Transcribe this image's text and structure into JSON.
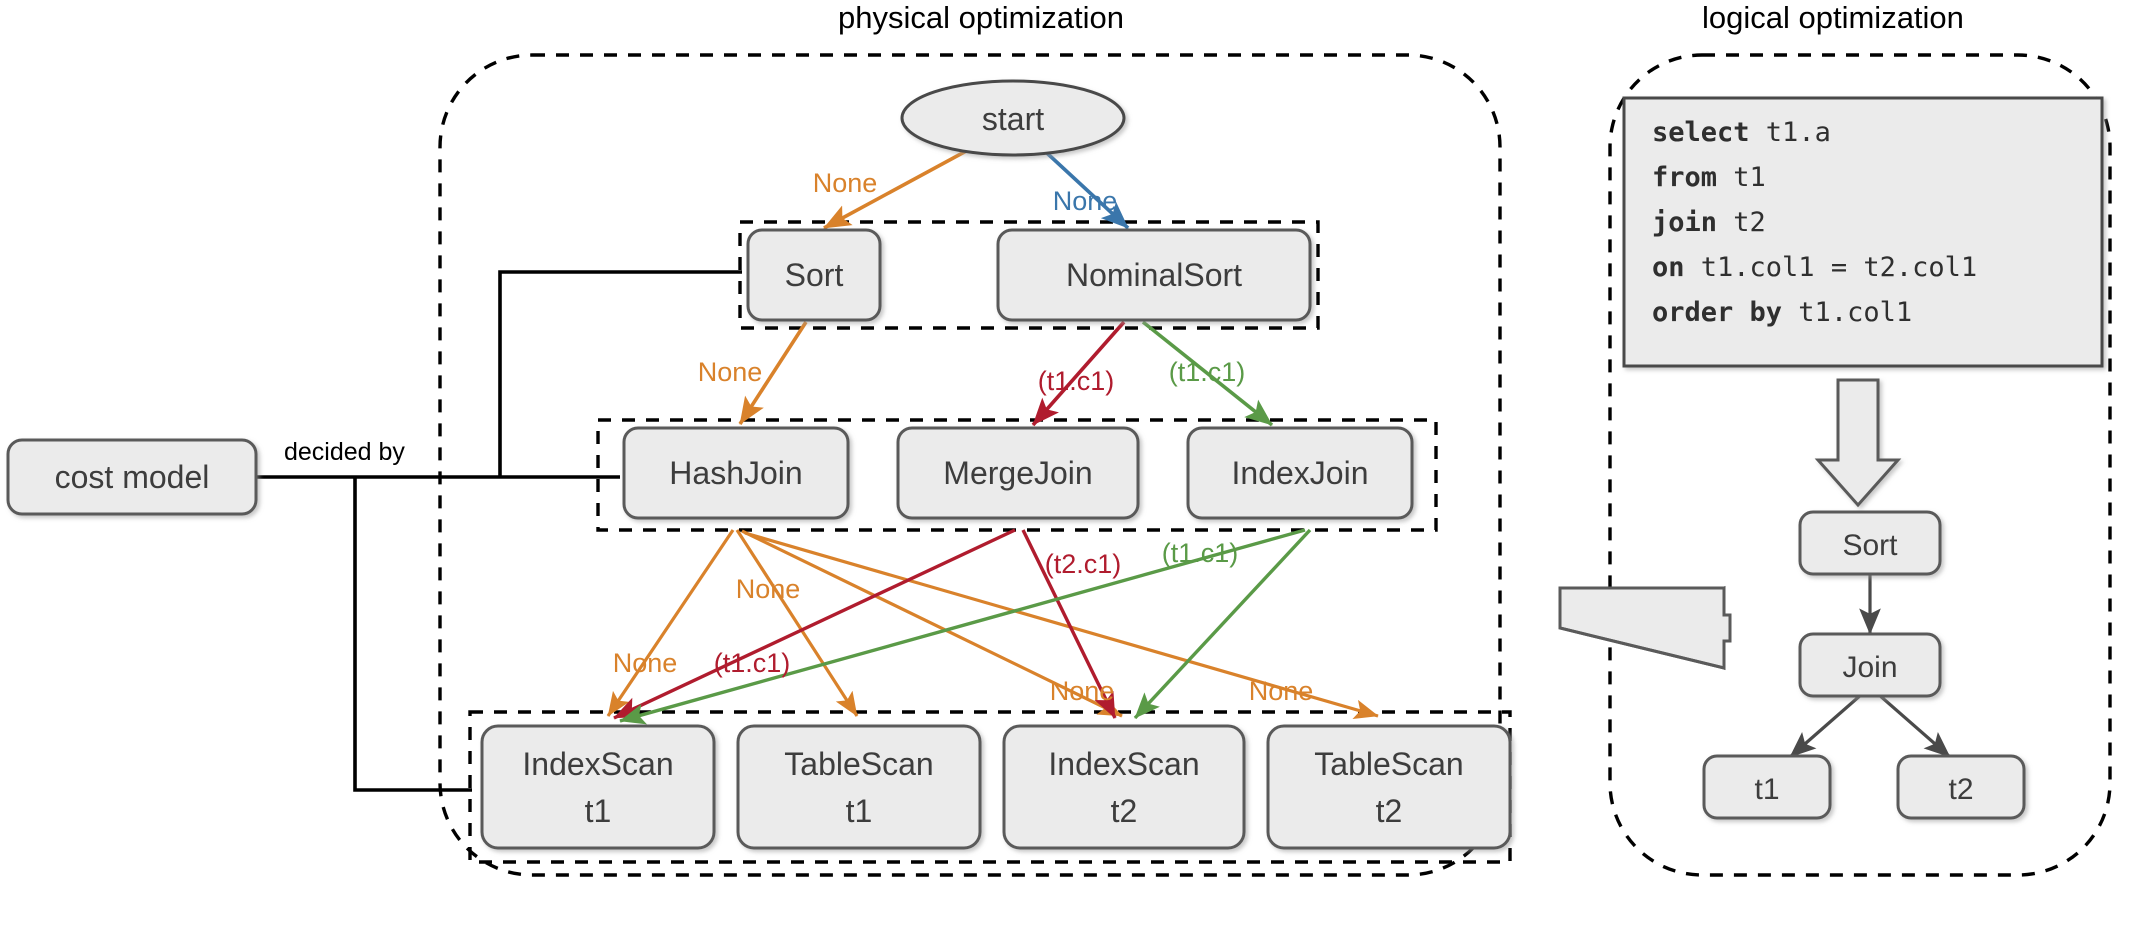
{
  "sections": {
    "physical": {
      "title": "physical optimization"
    },
    "logical": {
      "title": "logical optimization"
    }
  },
  "cost_model": {
    "label": "cost model",
    "edge_label": "decided by"
  },
  "physical": {
    "start_node": "start",
    "row_sort": [
      {
        "id": "sort",
        "label": "Sort"
      },
      {
        "id": "nominalsort",
        "label": "NominalSort"
      }
    ],
    "row_join": [
      {
        "id": "hashjoin",
        "label": "HashJoin"
      },
      {
        "id": "mergejoin",
        "label": "MergeJoin"
      },
      {
        "id": "indexjoin",
        "label": "IndexJoin"
      }
    ],
    "row_scan": [
      {
        "id": "indexscan_t1",
        "line1": "IndexScan",
        "line2": "t1"
      },
      {
        "id": "tablescan_t1",
        "line1": "TableScan",
        "line2": "t1"
      },
      {
        "id": "indexscan_t2",
        "line1": "IndexScan",
        "line2": "t2"
      },
      {
        "id": "tablescan_t2",
        "line1": "TableScan",
        "line2": "t2"
      }
    ],
    "edge_labels": {
      "start_to_sort": "None",
      "start_to_nominalsort": "None",
      "sort_to_hashjoin": "None",
      "nominalsort_to_mergejoin": "(t1.c1)",
      "nominalsort_to_indexjoin": "(t1.c1)",
      "hashjoin_to_indexscan_t1": "None",
      "hashjoin_to_tablescan_t1": "None",
      "hashjoin_to_indexscan_t2": "None",
      "hashjoin_to_tablescan_t2": "None",
      "mergejoin_to_indexscan_t1": "(t1.c1)",
      "mergejoin_to_indexscan_t2": "(t2.c1)",
      "indexjoin_to_indexscan_t1": "(t1.c1)"
    }
  },
  "logical": {
    "sql": [
      {
        "kw": "select",
        "rest": " t1.a"
      },
      {
        "kw": "from",
        "rest": " t1"
      },
      {
        "kw": "join",
        "rest": " t2"
      },
      {
        "kw": "on",
        "rest": " t1.col1 = t2.col1"
      },
      {
        "kw": "order by",
        "rest": " t1.col1"
      }
    ],
    "plan": {
      "sort": "Sort",
      "join": "Join",
      "t1": "t1",
      "t2": "t2"
    }
  },
  "colors": {
    "orange": "#d9822b",
    "blue": "#3a76ab",
    "red": "#b01c2e",
    "green": "#5a9a47",
    "node_fill": "#ebebeb",
    "node_stroke": "#5a5a5a",
    "text": "#3d3d3d",
    "black": "#000000"
  }
}
